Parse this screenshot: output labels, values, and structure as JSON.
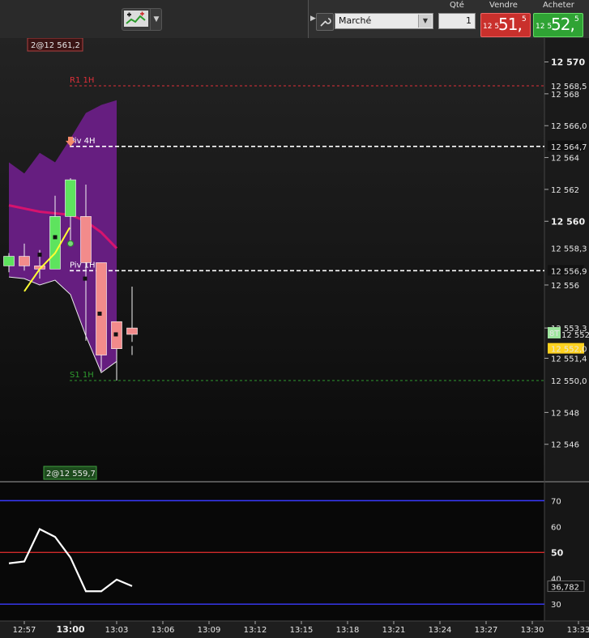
{
  "toolbar": {
    "tool_icon": "chart-tools-icon",
    "dropdown_icon": "chevron-down-icon"
  },
  "order": {
    "collapse_icon": "triangle-right-icon",
    "settings_icon": "wrench-icon",
    "type_value": "Marché",
    "qty_label": "Qté",
    "qty_value": "1",
    "sell_label": "Vendre",
    "buy_label": "Acheter",
    "sell_price": {
      "prefix": "12 5",
      "main": "51,",
      "sup": "5"
    },
    "buy_price": {
      "prefix": "12 5",
      "main": "52,",
      "sup": "5"
    }
  },
  "colors": {
    "resistance": "#e0303a",
    "pivot": "#ffffff",
    "support": "#2e9a2e",
    "band": "#6a1f86",
    "ma": "#d6136e",
    "bull": "#5ee35e",
    "bear": "#f28b8b",
    "oscillator_line": "#ffffff",
    "osc_level_blue": "#3a3aff",
    "osc_level_red": "#d02a2a"
  },
  "price_axis": {
    "ticks": [
      "12 570",
      "12 568",
      "12 566,0",
      "12 564",
      "12 562",
      "12 560",
      "12 556",
      "12 553,3",
      "12 551,4",
      "12 548",
      "12 546"
    ],
    "bold_ticks": [
      "12 570",
      "12 560"
    ]
  },
  "levels": [
    {
      "name": "R1 1H",
      "value": "12 568,5",
      "kind": "resistance"
    },
    {
      "name": "Piv 4H",
      "value": "12 564,7",
      "kind": "pivot"
    },
    {
      "name": "Piv 1H",
      "value": "12 556,9",
      "kind": "pivot"
    },
    {
      "name": "S1 1H",
      "value": "12 550,0",
      "kind": "support"
    }
  ],
  "markers": {
    "top_box": "2@12 561,2",
    "bottom_box": "2@12 559,7",
    "ma_label": "12 558,3",
    "current_price": "12 552,0",
    "bt_badge": "8T",
    "bt_value": "12 552,9"
  },
  "oscillator": {
    "axis_ticks": [
      "70",
      "60",
      "50",
      "40",
      "30"
    ],
    "bold_ticks": [
      "50"
    ],
    "value": "36,782"
  },
  "time_axis": {
    "ticks": [
      "12:57",
      "13:00",
      "13:03",
      "13:06",
      "13:09",
      "13:12",
      "13:15",
      "13:18",
      "13:21",
      "13:24",
      "13:27",
      "13:30",
      "13:33"
    ],
    "bold_ticks": [
      "13:00"
    ]
  },
  "chart_data": {
    "type": "candlestick",
    "x": [
      "12:56",
      "12:57",
      "12:58",
      "12:59",
      "13:00",
      "13:01",
      "13:02",
      "13:03",
      "13:04"
    ],
    "series": [
      {
        "open": 12557.2,
        "high": 12558.0,
        "low": 12556.8,
        "close": 12557.8
      },
      {
        "open": 12557.8,
        "high": 12558.6,
        "low": 12556.9,
        "close": 12557.2
      },
      {
        "open": 12557.2,
        "high": 12558.2,
        "low": 12556.4,
        "close": 12557.0
      },
      {
        "open": 12557.0,
        "high": 12561.6,
        "low": 12557.0,
        "close": 12560.3
      },
      {
        "open": 12560.3,
        "high": 12562.7,
        "low": 12558.7,
        "close": 12562.6
      },
      {
        "open": 12560.3,
        "high": 12562.3,
        "low": 12552.5,
        "close": 12557.4
      },
      {
        "open": 12557.4,
        "high": 12557.4,
        "low": 12550.6,
        "close": 12551.6
      },
      {
        "open": 12553.7,
        "high": 12553.7,
        "low": 12550.0,
        "close": 12552.0
      },
      {
        "open": 12553.3,
        "high": 12555.9,
        "low": 12551.6,
        "close": 12552.9
      }
    ],
    "ma": [
      12561.0,
      12560.8,
      12560.6,
      12560.5,
      12560.4,
      12560.0,
      12559.3,
      12558.3
    ],
    "band_upper": [
      12563.7,
      12563.0,
      12564.3,
      12563.7,
      12565.2,
      12566.8,
      12567.3,
      12567.6
    ],
    "band_lower": [
      12556.5,
      12556.4,
      12556.0,
      12556.3,
      12555.4,
      12552.8,
      12550.5,
      12551.2
    ],
    "oscillator_series": [
      45.8,
      46.5,
      59.0,
      56.0,
      48.0,
      35.0,
      35.0,
      39.5,
      37.0
    ],
    "ylim": [
      12543.7,
      12571.5
    ],
    "osc_ylim": [
      23.5,
      77.0
    ]
  }
}
